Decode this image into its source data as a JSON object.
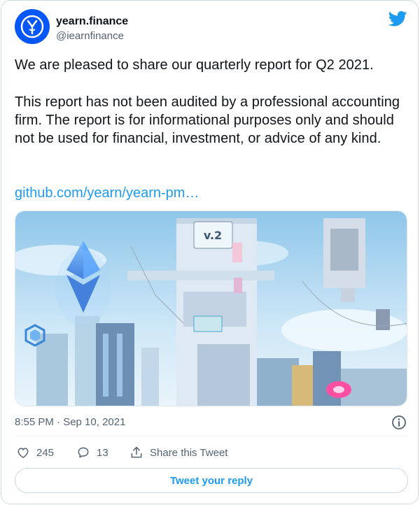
{
  "account": {
    "name": "yearn.finance",
    "handle": "@iearnfinance"
  },
  "tweet": {
    "line1": "We are pleased to share our quarterly report for Q2 2021.",
    "disclaimer": "This report has not been audited by a professional accounting firm. The report is for informational purposes only and should not be used for financial, investment, or advice of any kind.",
    "link": "github.com/yearn/yearn-pm…",
    "timestamp": "8:55 PM · Sep 10, 2021"
  },
  "media": {
    "sign_text": "v.2",
    "colors": {
      "sky": "#bfe0f4",
      "eth": "#3f8be8",
      "building": "#dfe9f3"
    }
  },
  "actions": {
    "likes": "245",
    "replies": "13",
    "share_label": "Share this Tweet"
  },
  "reply_button": "Tweet your reply",
  "colors": {
    "brand_blue": "#1d9bf0",
    "avatar_blue": "#0657f9",
    "muted": "#536471"
  }
}
